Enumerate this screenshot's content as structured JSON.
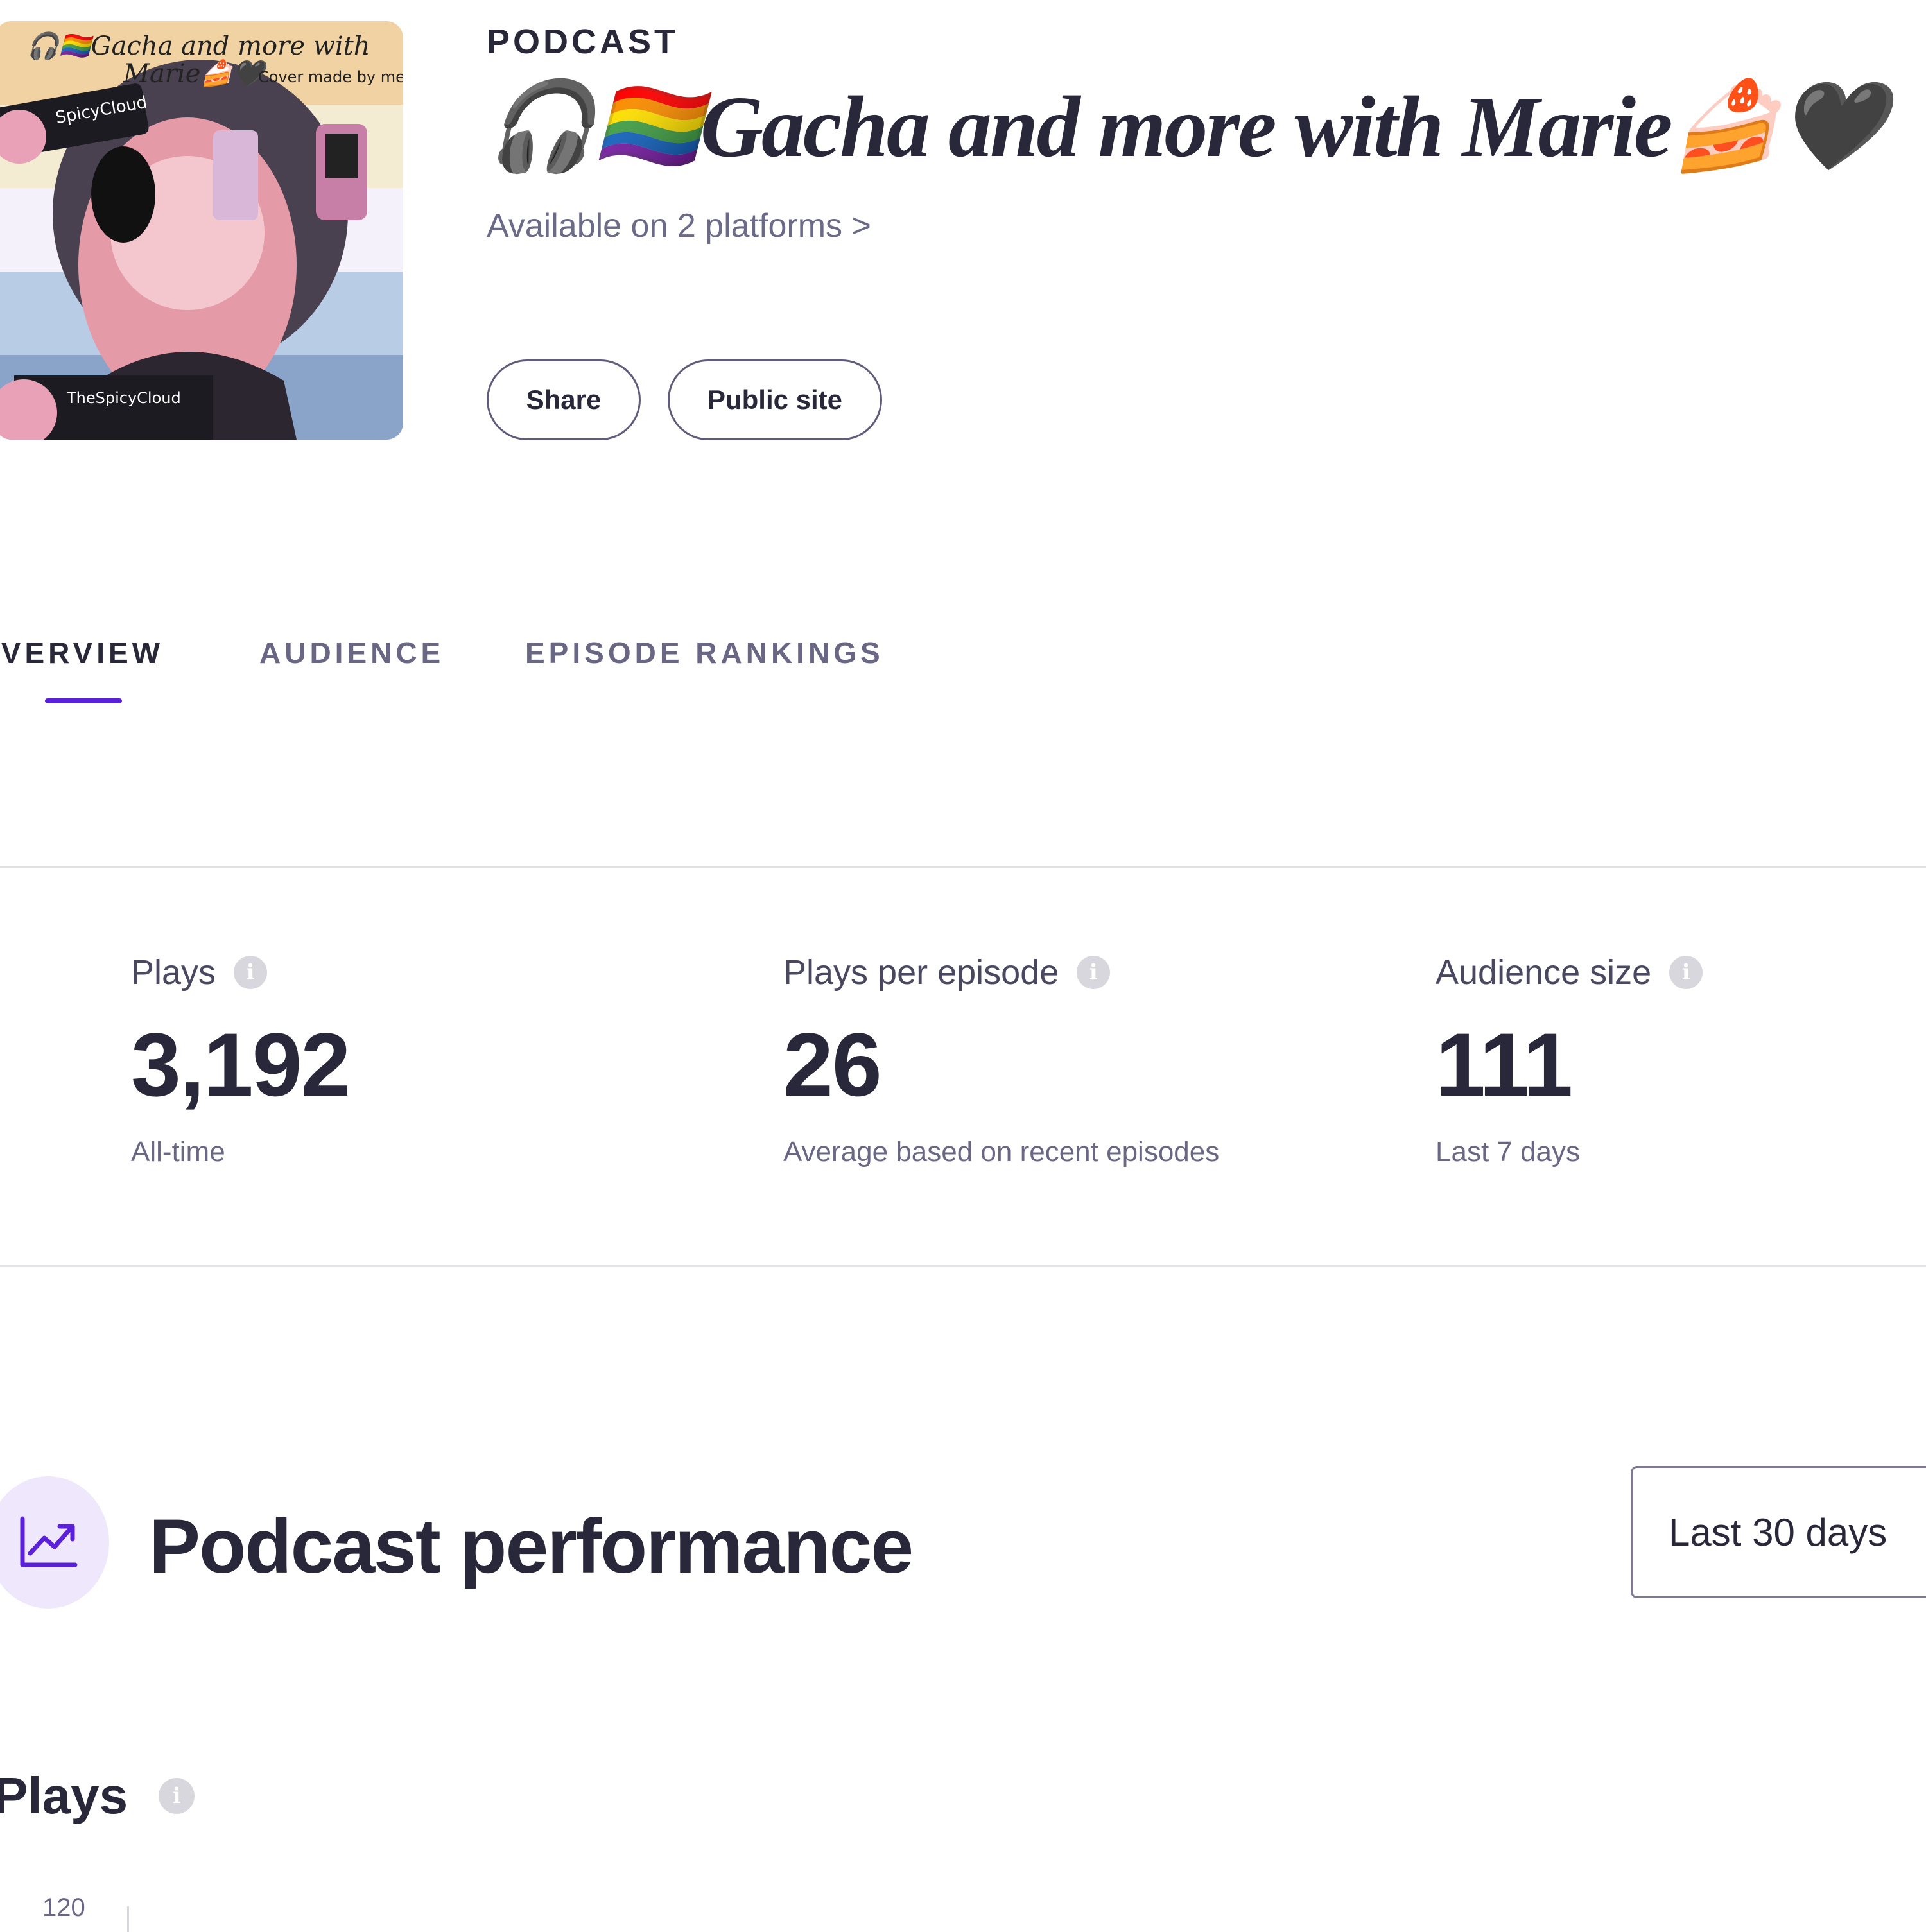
{
  "header": {
    "kind_label": "PODCAST",
    "title": "🎧🏳️‍🌈Gacha and more with Marie🍰🖤",
    "platforms_link": "Available on 2 platforms >",
    "cover_art": {
      "text_line1": "🎧🏳️‍🌈Gacha and more with",
      "text_line2": "Marie🍰🖤",
      "note": "Cover made by me",
      "name_top": "SpicyCloud",
      "name_bottom": "TheSpicyCloud"
    },
    "buttons": {
      "share": "Share",
      "public_site": "Public site"
    }
  },
  "tabs": [
    {
      "label": "OVERVIEW",
      "active": true
    },
    {
      "label": "AUDIENCE",
      "active": false
    },
    {
      "label": "EPISODE RANKINGS",
      "active": false
    }
  ],
  "stats": [
    {
      "label": "Plays",
      "value": "3,192",
      "sub": "All-time"
    },
    {
      "label": "Plays per episode",
      "value": "26",
      "sub": "Average based on recent episodes"
    },
    {
      "label": "Audience size",
      "value": "111",
      "sub": "Last 7 days"
    }
  ],
  "performance": {
    "title": "Podcast performance",
    "range": "Last 30 days",
    "plays_heading": "Plays",
    "y_tick_top": "120"
  },
  "colors": {
    "accent": "#5b21d8",
    "text_primary": "#29283a",
    "text_secondary": "#6a6785",
    "divider": "#e2e1e8"
  },
  "icons": {
    "info": "info-icon",
    "performance": "trend-chart-icon"
  }
}
